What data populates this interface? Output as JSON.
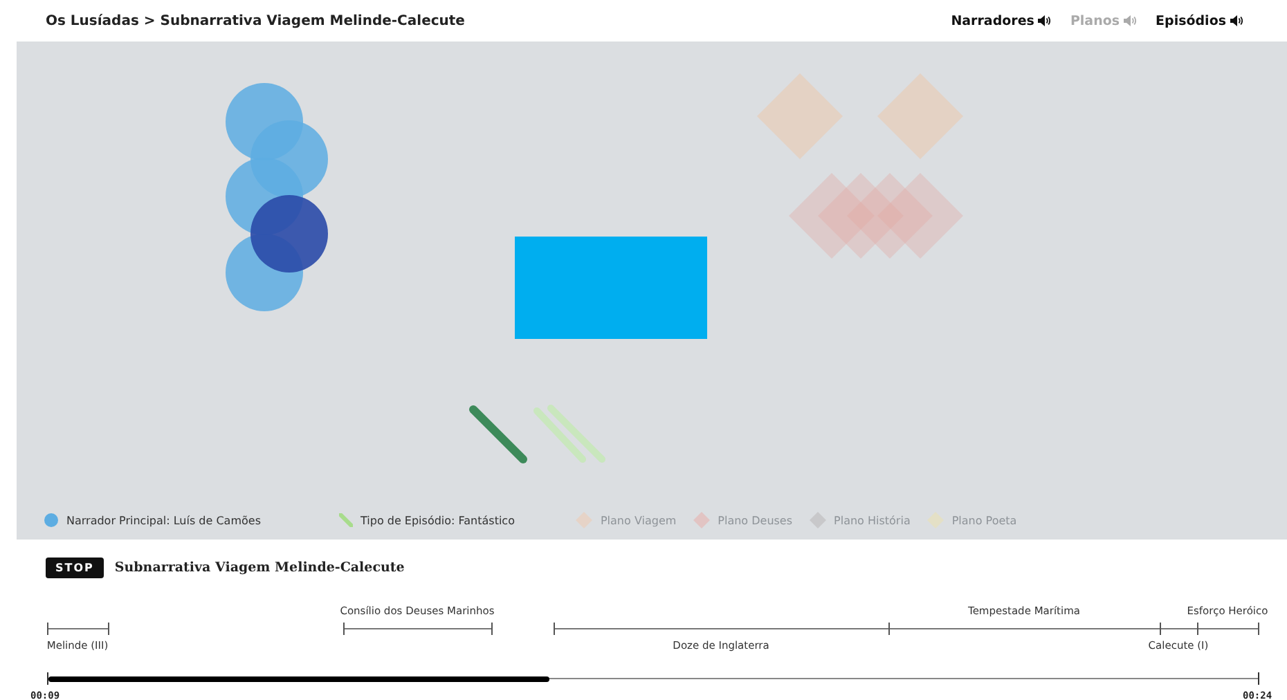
{
  "breadcrumb": "Os Lusíadas > Subnarrativa Viagem Melinde-Calecute",
  "nav": [
    {
      "label": "Narradores",
      "on": true
    },
    {
      "label": "Planos",
      "on": false
    },
    {
      "label": "Episódios",
      "on": true
    }
  ],
  "legend": [
    {
      "kind": "dot",
      "label": "Narrador Principal: Luís de Camões",
      "color": "#5dade2",
      "on": true
    },
    {
      "kind": "stroke",
      "label": "Tipo de Episódio: Fantástico",
      "color": "#a8dc8c",
      "on": true
    },
    {
      "kind": "diamond",
      "label": "Plano Viagem",
      "color": "#e6d3c7",
      "on": false
    },
    {
      "kind": "diamond",
      "label": "Plano Deuses",
      "color": "#e2c4c3",
      "on": false
    },
    {
      "kind": "diamond",
      "label": "Plano História",
      "color": "#c8c8ca",
      "on": false
    },
    {
      "kind": "diamond",
      "label": "Plano Poeta",
      "color": "#e4e0c6",
      "on": false
    }
  ],
  "stop_button": "STOP",
  "title": "Subnarrativa Viagem Melinde-Calecute",
  "segments": [
    {
      "label": "Melinde (III)"
    },
    {
      "label": "Consílio dos Deuses Marinhos"
    },
    {
      "label": "Doze de Inglaterra"
    },
    {
      "label": "Tempestade Marítima"
    },
    {
      "label": "Calecute (I)"
    },
    {
      "label": "Esforço Heróico"
    }
  ],
  "progress": {
    "level": 0.414,
    "start": "00:09",
    "end": "00:24"
  }
}
